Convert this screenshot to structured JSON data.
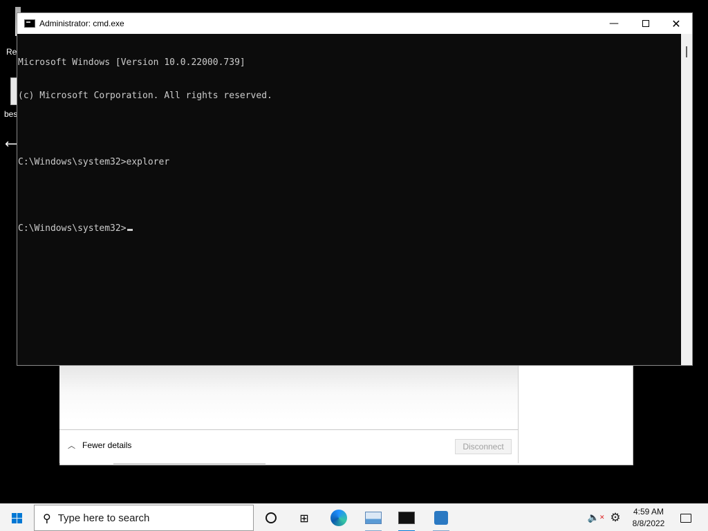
{
  "desktop": {
    "icons": [
      {
        "label": "Rec",
        "icon": "recycle-bin-icon"
      },
      {
        "label": "best",
        "icon": "shortcut-icon"
      }
    ],
    "cursor": "resize-horizontal-cursor"
  },
  "background_dialog": {
    "fewer_details_label": "Fewer details",
    "disconnect_label": "Disconnect"
  },
  "cmd_window": {
    "title": "Administrator: cmd.exe",
    "lines": [
      "Microsoft Windows [Version 10.0.22000.739]",
      "(c) Microsoft Corporation. All rights reserved.",
      "",
      "C:\\Windows\\system32>explorer",
      "",
      "C:\\Windows\\system32>"
    ]
  },
  "taskbar": {
    "search_placeholder": "Type here to search",
    "apps": [
      "task-view-icon",
      "widgets-icon",
      "edge-icon",
      "performance-monitor-icon",
      "command-prompt-icon",
      "server-manager-icon"
    ],
    "clock_time": "4:59 AM",
    "clock_date": "8/8/2022",
    "accent": "#0078d4"
  }
}
